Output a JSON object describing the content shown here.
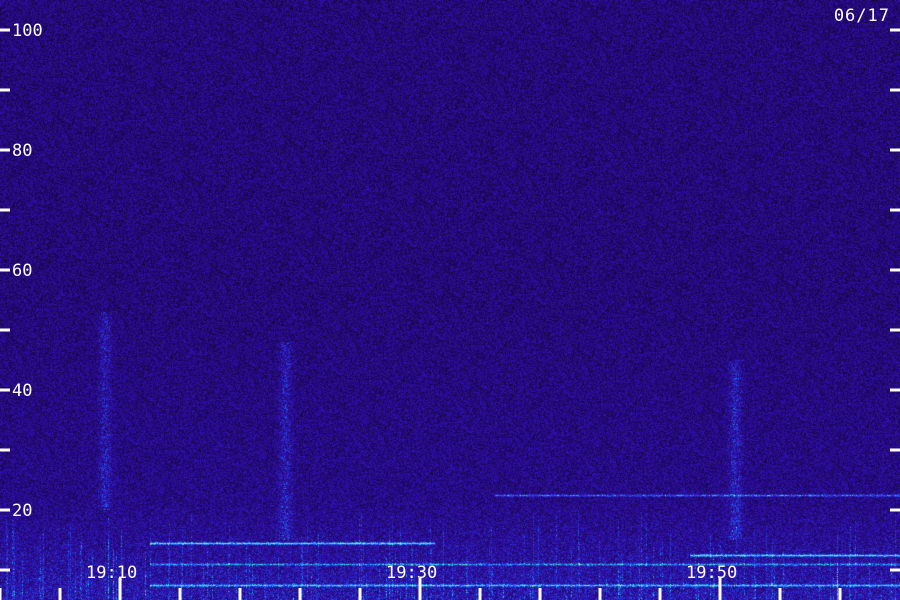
{
  "date_label": "06/17",
  "colors": {
    "background": "#1a0a6b",
    "text": "#ffffff",
    "band_cyan": "#3fd0ff",
    "band_green": "#7dff8a"
  },
  "chart_data": {
    "type": "heatmap",
    "title": "",
    "xlabel": "",
    "ylabel": "",
    "y_range": [
      0,
      100
    ],
    "y_ticks": [
      10,
      20,
      30,
      40,
      50,
      60,
      70,
      80,
      90,
      100
    ],
    "y_tick_labels": [
      "20",
      "40",
      "60",
      "80",
      "100"
    ],
    "x_tick_labels": [
      "19:10",
      "19:30",
      "19:50"
    ],
    "x_range_minutes": [
      "19:02",
      "20:02"
    ],
    "x_major_ticks": [
      "19:10",
      "19:30",
      "19:50"
    ],
    "x_minor_ticks": [
      "19:02",
      "19:06",
      "19:14",
      "19:18",
      "19:22",
      "19:26",
      "19:34",
      "19:38",
      "19:42",
      "19:46",
      "19:54",
      "19:58"
    ],
    "grid": false,
    "legend": "none",
    "colormap": "dark purple to blue/cyan/green (low to high intensity)",
    "features": [
      {
        "kind": "horizontal_band",
        "level": 14.5,
        "from": "19:12",
        "to": "19:31",
        "intensity": 0.8
      },
      {
        "kind": "horizontal_band",
        "level": 7.5,
        "from": "19:12",
        "to": "20:02",
        "intensity": 0.6
      },
      {
        "kind": "horizontal_band",
        "level": 11,
        "from": "19:12",
        "to": "20:02",
        "intensity": 0.5
      },
      {
        "kind": "horizontal_band",
        "level": 22.5,
        "from": "19:35",
        "to": "20:02",
        "intensity": 0.5
      },
      {
        "kind": "horizontal_band",
        "level": 12.5,
        "from": "19:48",
        "to": "20:02",
        "intensity": 0.75
      },
      {
        "kind": "vertical_burst",
        "at": "19:09",
        "from_level": 20,
        "to_level": 53,
        "intensity": 0.35
      },
      {
        "kind": "vertical_burst",
        "at": "19:21",
        "from_level": 15,
        "to_level": 48,
        "intensity": 0.35
      },
      {
        "kind": "vertical_burst",
        "at": "19:51",
        "from_level": 15,
        "to_level": 45,
        "intensity": 0.4
      }
    ]
  }
}
